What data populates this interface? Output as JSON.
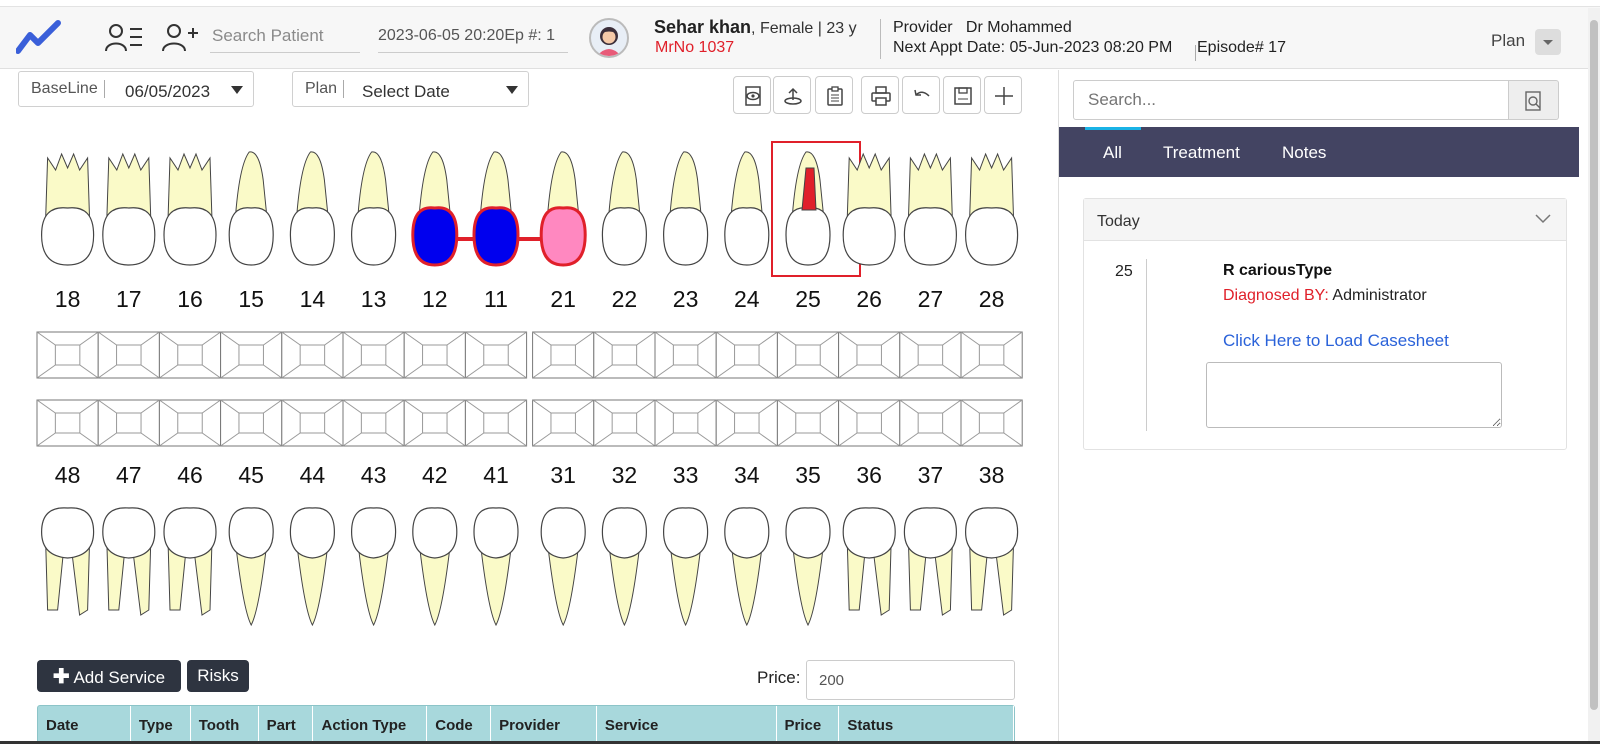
{
  "header": {
    "search_placeholder": "Search Patient",
    "episode_text": "2023-06-05 20:20Ep #: 1",
    "patient_name": "Sehar khan",
    "patient_meta": ", Female | 23 y",
    "mrno": "MrNo 1037",
    "provider_label": "Provider",
    "provider_name": "Dr Mohammed",
    "next_appt_label": "Next Appt Date:",
    "next_appt_value": "05-Jun-2023 08:20 PM",
    "episode_label": "Episode# 17",
    "plan_label": "Plan"
  },
  "controls": {
    "baseline_label": "BaseLine",
    "baseline_value": "06/05/2023",
    "plan_label": "Plan",
    "plan_value": "Select Date"
  },
  "toolbar": [
    "view-icon",
    "upload-icon",
    "clipboard-icon",
    "print-icon",
    "undo-icon",
    "save-icon",
    "plus-icon"
  ],
  "teeth": {
    "upper": [
      "18",
      "17",
      "16",
      "15",
      "14",
      "13",
      "12",
      "11",
      "21",
      "22",
      "23",
      "24",
      "25",
      "26",
      "27",
      "28"
    ],
    "lower": [
      "48",
      "47",
      "46",
      "45",
      "44",
      "43",
      "42",
      "41",
      "31",
      "32",
      "33",
      "34",
      "35",
      "36",
      "37",
      "38"
    ],
    "selected": "25",
    "colors": {
      "crown_blue": "#0000ee",
      "crown_pink": "#ff88c0",
      "highlight_red": "#e0202a",
      "root": "#fafac8"
    }
  },
  "actions": {
    "add_service": "Add Service",
    "risks": "Risks",
    "price_label": "Price:",
    "price_value": "200"
  },
  "table": {
    "columns": [
      "Date",
      "Type",
      "Tooth",
      "Part",
      "Action Type",
      "Code",
      "Provider",
      "Service",
      "Price",
      "Status"
    ]
  },
  "right": {
    "search_placeholder": "Search...",
    "tabs": [
      "All",
      "Treatment",
      "Notes"
    ],
    "today_label": "Today",
    "entry": {
      "tooth": "25",
      "type": "R cariousType",
      "diagnosed_label": "Diagnosed BY:",
      "diagnosed_by": "Administrator",
      "link": "Click Here to Load Casesheet"
    }
  }
}
